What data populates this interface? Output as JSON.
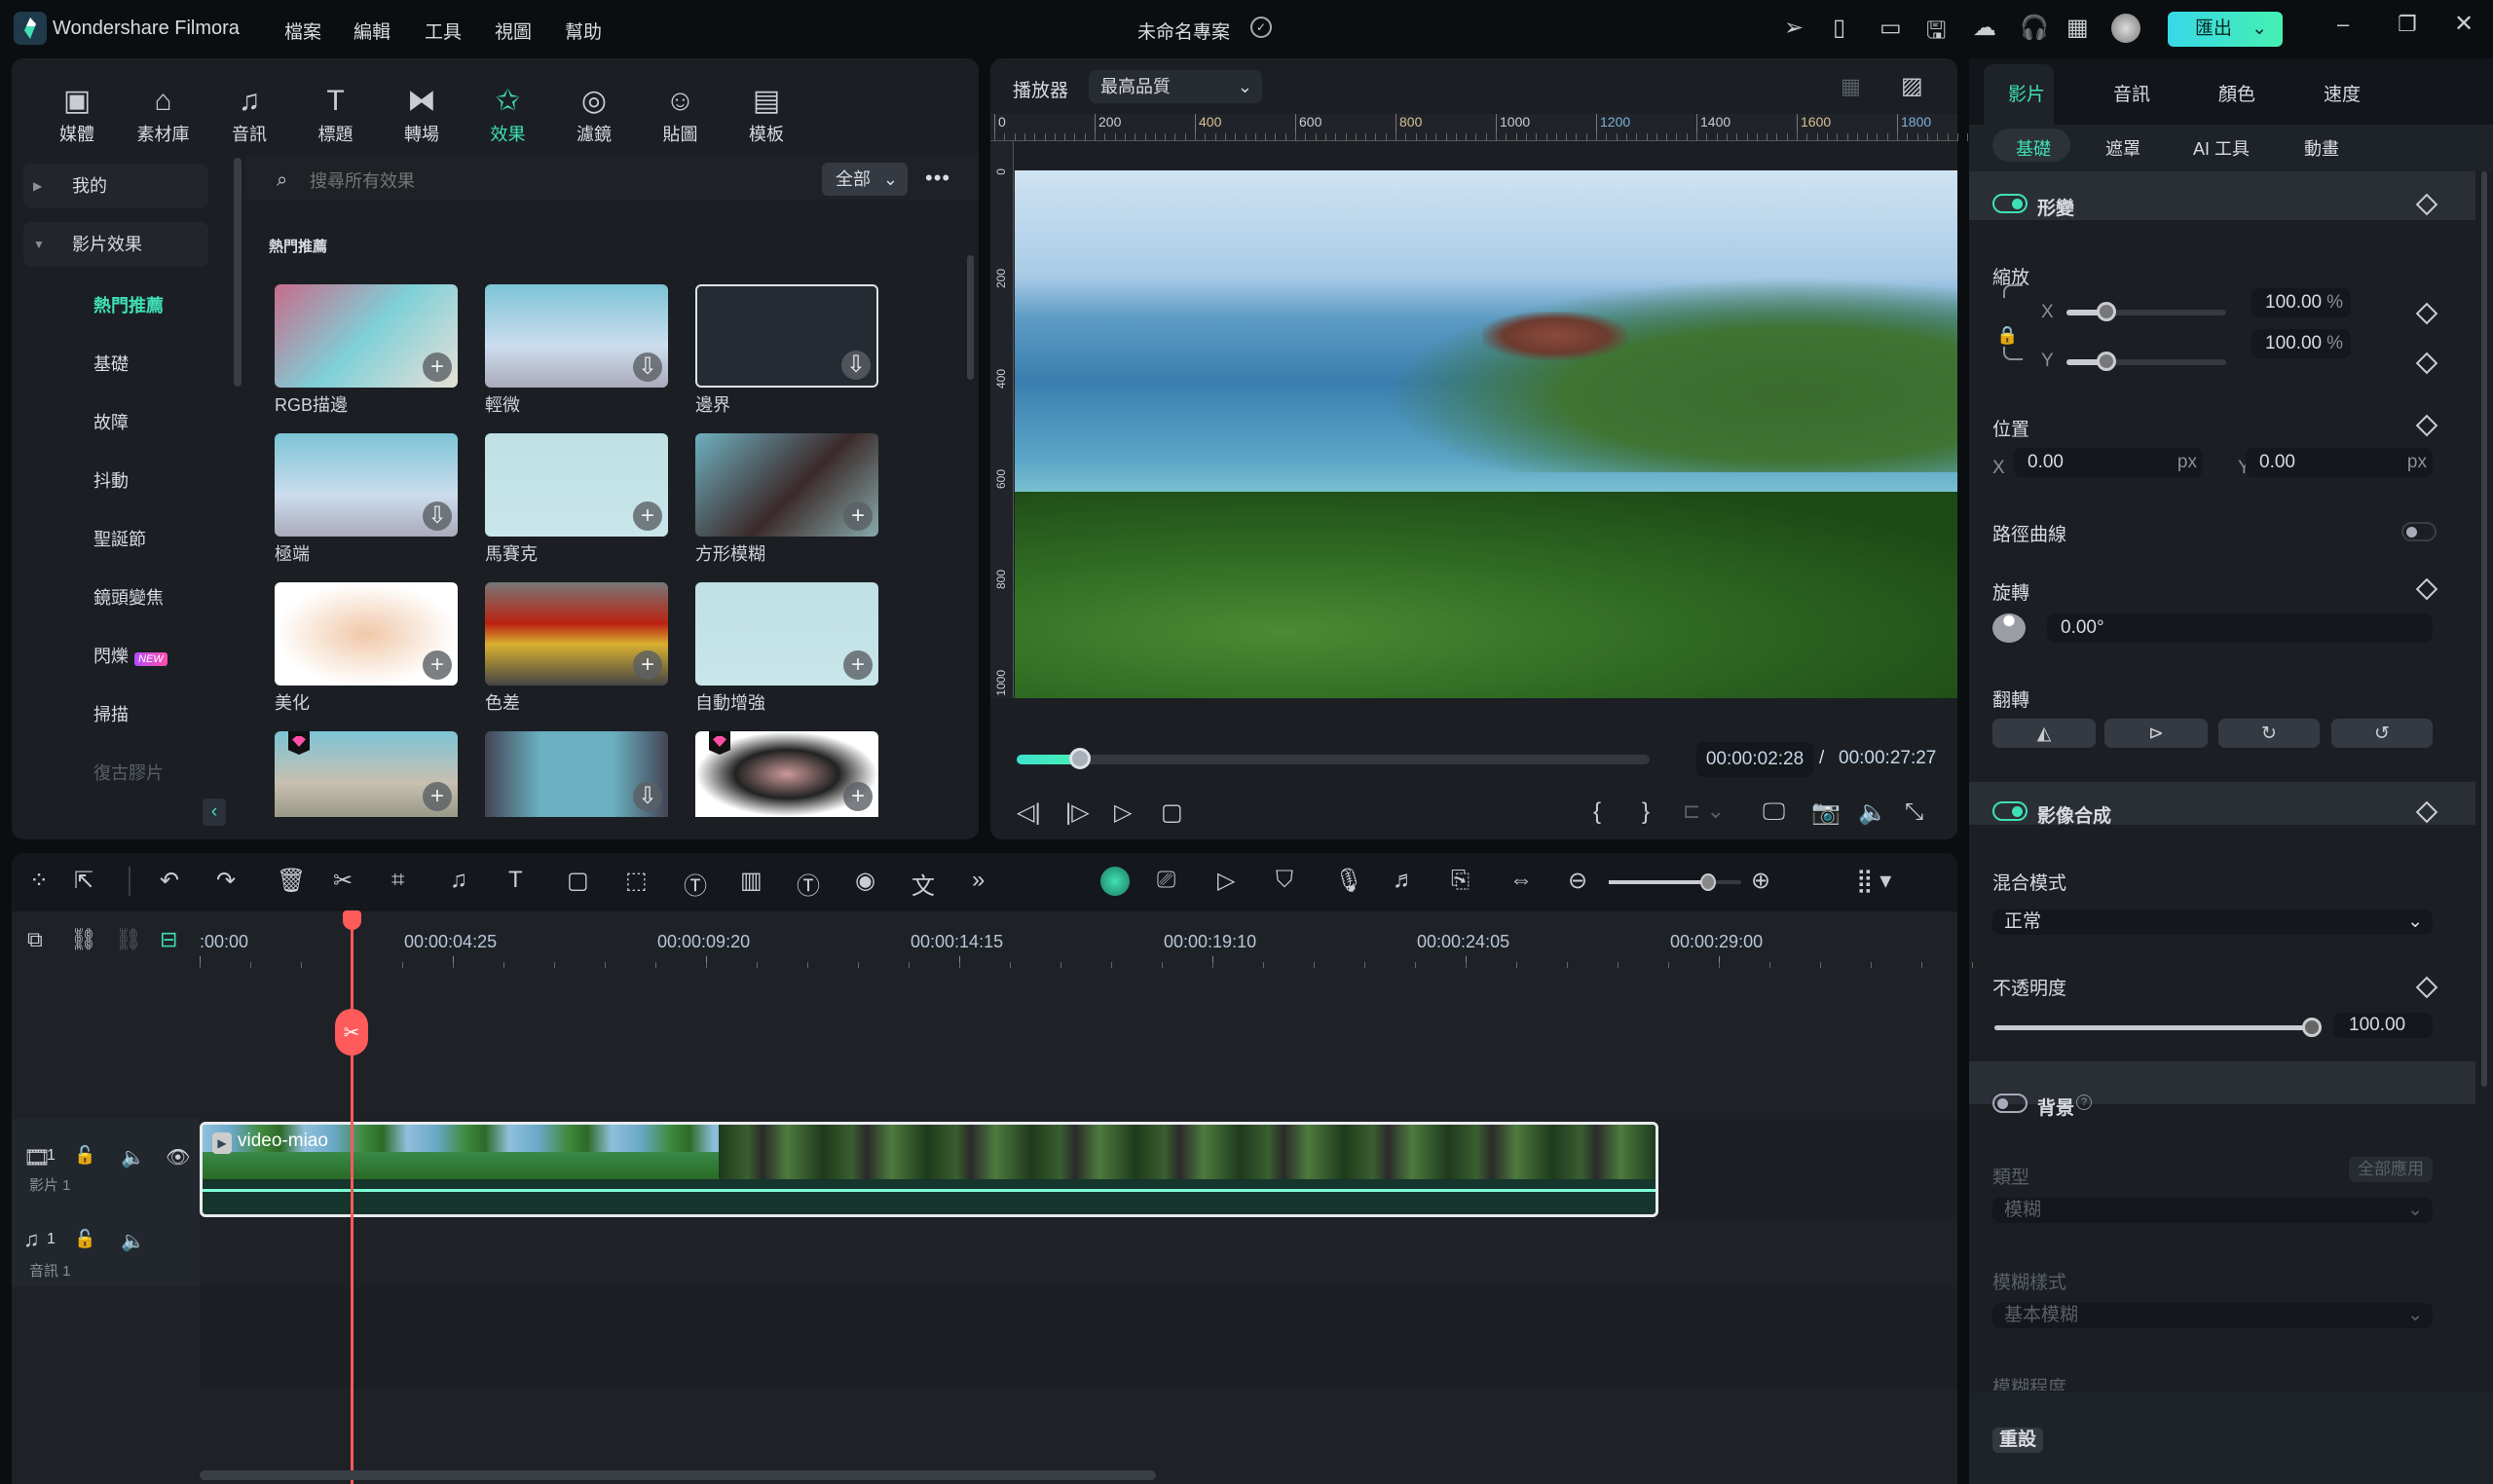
{
  "app": {
    "name": "Wondershare Filmora",
    "menu": [
      "檔案",
      "編輯",
      "工具",
      "視圖",
      "幫助"
    ],
    "project_title": "未命名專案",
    "export_label": "匯出",
    "title_icons": [
      "send-icon",
      "phone-timer-icon",
      "layout-icon",
      "save-icon",
      "cloud-upload-icon",
      "headset-icon",
      "grid-apps-icon",
      "avatar"
    ]
  },
  "media_tabs": [
    {
      "label": "媒體",
      "icon": "media-icon"
    },
    {
      "label": "素材庫",
      "icon": "stock-icon"
    },
    {
      "label": "音訊",
      "icon": "music-icon"
    },
    {
      "label": "標題",
      "icon": "title-icon"
    },
    {
      "label": "轉場",
      "icon": "transition-icon"
    },
    {
      "label": "效果",
      "icon": "effects-icon",
      "active": true
    },
    {
      "label": "濾鏡",
      "icon": "filter-icon"
    },
    {
      "label": "貼圖",
      "icon": "sticker-icon"
    },
    {
      "label": "模板",
      "icon": "template-icon"
    }
  ],
  "sidebar": {
    "groups": [
      {
        "label": "我的"
      },
      {
        "label": "影片效果"
      }
    ],
    "items": [
      "熱門推薦",
      "基礎",
      "故障",
      "抖動",
      "聖誕節",
      "鏡頭變焦",
      "閃爍",
      "掃描",
      "復古膠片"
    ],
    "new_badge": "NEW"
  },
  "search": {
    "placeholder": "搜尋所有效果",
    "filter": "全部"
  },
  "effects": {
    "section": "熱門推薦",
    "items": [
      {
        "name": "RGB描邊",
        "action": "add"
      },
      {
        "name": "輕微",
        "action": "download"
      },
      {
        "name": "邊界",
        "action": "download"
      },
      {
        "name": "極端",
        "action": "download"
      },
      {
        "name": "馬賽克",
        "action": "add"
      },
      {
        "name": "方形模糊",
        "action": "add"
      },
      {
        "name": "美化",
        "action": "add"
      },
      {
        "name": "色差",
        "action": "add"
      },
      {
        "name": "自動增強",
        "action": "add"
      },
      {
        "name": "",
        "action": "add",
        "premium": true
      },
      {
        "name": "",
        "action": "download"
      },
      {
        "name": "",
        "action": "add",
        "premium": true
      }
    ]
  },
  "player": {
    "label": "播放器",
    "quality": "最高品質",
    "ruler": [
      "0",
      "200",
      "400",
      "600",
      "800",
      "1000",
      "1200",
      "1400",
      "1600",
      "1800"
    ],
    "vruler": [
      "0",
      "200",
      "400",
      "600",
      "800",
      "1000"
    ],
    "current_time": "00:00:02:28",
    "separator": "/",
    "total_time": "00:00:27:27",
    "progress": 0.1
  },
  "inspector": {
    "tabs": [
      "影片",
      "音訊",
      "顏色",
      "速度"
    ],
    "subtabs": [
      "基礎",
      "遮罩",
      "AI 工具",
      "動畫"
    ],
    "transform": {
      "title": "形變",
      "enabled": true,
      "scale_label": "縮放",
      "x": "X",
      "y": "Y",
      "scale_x": "100.00",
      "scale_y": "100.00",
      "percent": "%",
      "scale_slider": 0.25,
      "position_label": "位置",
      "pos_x": "0.00",
      "pos_y": "0.00",
      "px": "px",
      "path_curve": "路徑曲線",
      "rotate_label": "旋轉",
      "rotate": "0.00°",
      "flip_label": "翻轉"
    },
    "composite": {
      "title": "影像合成",
      "enabled": true,
      "blend_label": "混合模式",
      "blend": "正常",
      "opacity_label": "不透明度",
      "opacity": "100.00",
      "opacity_level": 1.0
    },
    "background": {
      "title": "背景",
      "enabled": false,
      "type_label": "類型",
      "apply_all": "全部應用",
      "type": "模糊",
      "style_label": "模糊樣式",
      "style": "基本模糊",
      "degree_label": "模糊程度"
    },
    "reset": "重設"
  },
  "timeline": {
    "ticks": [
      ":00:00",
      "00:00:04:25",
      "00:00:09:20",
      "00:00:14:15",
      "00:00:19:10",
      "00:00:24:05",
      "00:00:29:00"
    ],
    "tracks": [
      {
        "num": "1",
        "label": "影片 1"
      },
      {
        "num": "1",
        "label": "音訊 1"
      }
    ],
    "clip": "video-miao",
    "zoom": 0.75,
    "tools": [
      "scene-detect-icon",
      "select-icon",
      "undo-icon",
      "redo-icon",
      "delete-icon",
      "cut-icon",
      "crop-icon",
      "audio-icon",
      "text-icon",
      "shape-icon",
      "mask-icon",
      "ai-text-icon",
      "audio-wave-icon",
      "tts-icon",
      "voice-icon",
      "translate-icon",
      "more-icon"
    ]
  },
  "colors": {
    "accent": "#3fe0b5",
    "playhead": "#ff5b5b",
    "panel": "#1b1f24"
  }
}
